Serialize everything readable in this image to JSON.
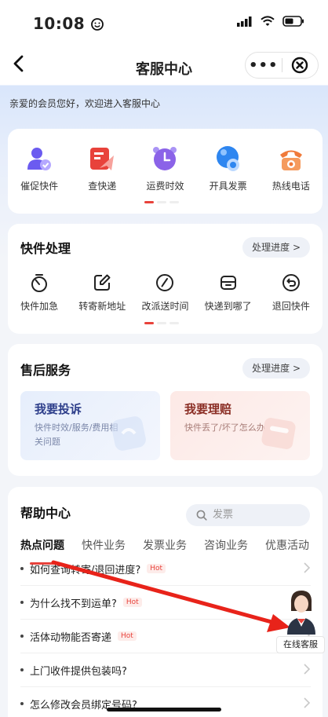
{
  "status": {
    "time": "10:08",
    "face_icon": "smiley-icon",
    "signal_icon": "signal-icon",
    "wifi_icon": "wifi-icon",
    "battery_icon": "battery-icon"
  },
  "nav": {
    "title": "客服中心",
    "more": "•••",
    "back_icon": "chevron-left-icon",
    "close_icon": "close-circle-icon"
  },
  "greeting": "亲爱的会员您好，欢迎进入客服中心",
  "quick": [
    {
      "label": "催促快件",
      "icon": "user-check-icon",
      "color": "#6b5bf0"
    },
    {
      "label": "查快递",
      "icon": "paper-plane-icon",
      "color": "#e8423b"
    },
    {
      "label": "运费时效",
      "icon": "alarm-clock-icon",
      "color": "#8b63e8"
    },
    {
      "label": "开具发票",
      "icon": "invoice-coin-icon",
      "color": "#2e86f0"
    },
    {
      "label": "热线电话",
      "icon": "telephone-icon",
      "color": "#f07a3a"
    }
  ],
  "express": {
    "title": "快件处理",
    "progress_label": "处理进度 >",
    "items": [
      {
        "label": "快件加急",
        "icon": "stopwatch-icon"
      },
      {
        "label": "转寄新地址",
        "icon": "edit-icon"
      },
      {
        "label": "改派送时间",
        "icon": "clock-icon"
      },
      {
        "label": "快递到哪了",
        "icon": "parcel-icon"
      },
      {
        "label": "退回快件",
        "icon": "return-icon"
      }
    ]
  },
  "aftersale": {
    "title": "售后服务",
    "progress_label": "处理进度 >",
    "complaint": {
      "title": "我要投诉",
      "desc": "快件时效/服务/费用相关问题"
    },
    "claim": {
      "title": "我要理赔",
      "desc": "快件丢了/坏了怎么办"
    }
  },
  "help": {
    "title": "帮助中心",
    "search_placeholder": "发票",
    "tabs": [
      "热点问题",
      "快件业务",
      "发票业务",
      "咨询业务",
      "优惠活动"
    ],
    "active_tab": 0,
    "hot_label": "Hot",
    "faqs": [
      {
        "q": "如何查询转寄/退回进度?",
        "hot": true
      },
      {
        "q": "为什么找不到运单?",
        "hot": true
      },
      {
        "q": "活体动物能否寄递",
        "hot": true
      },
      {
        "q": "上门收件提供包装吗?",
        "hot": false
      },
      {
        "q": "怎么修改会员绑定号码?",
        "hot": false
      }
    ]
  },
  "online_agent": {
    "label": "在线客服"
  },
  "colors": {
    "accent_red": "#e8423b",
    "annotation_arrow": "#e8231a"
  }
}
